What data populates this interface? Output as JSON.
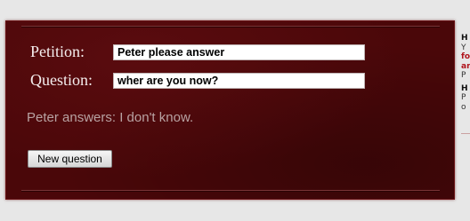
{
  "form": {
    "petition_label": "Petition:",
    "petition_value": "Peter please answer",
    "question_label": "Question:",
    "question_value": "wher are you now?",
    "answer": "Peter answers: I don't know.",
    "new_question_label": "New question"
  },
  "side_column": {
    "lines": [
      "H",
      "Y",
      "fo",
      "an",
      "P",
      "H",
      "P",
      "o"
    ]
  }
}
